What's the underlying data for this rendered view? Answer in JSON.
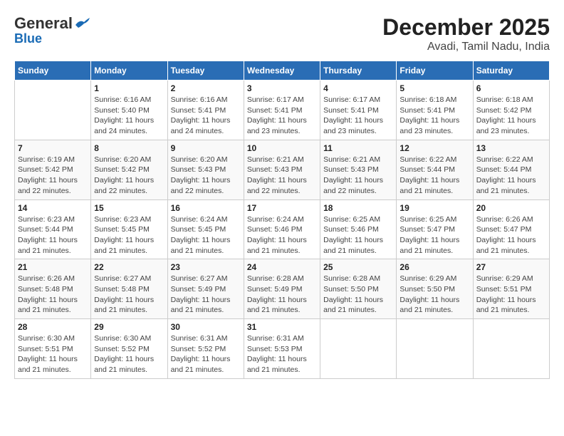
{
  "logo": {
    "general": "General",
    "blue": "Blue"
  },
  "title": "December 2025",
  "subtitle": "Avadi, Tamil Nadu, India",
  "days_of_week": [
    "Sunday",
    "Monday",
    "Tuesday",
    "Wednesday",
    "Thursday",
    "Friday",
    "Saturday"
  ],
  "weeks": [
    [
      {
        "day": "",
        "info": ""
      },
      {
        "day": "1",
        "info": "Sunrise: 6:16 AM\nSunset: 5:40 PM\nDaylight: 11 hours\nand 24 minutes."
      },
      {
        "day": "2",
        "info": "Sunrise: 6:16 AM\nSunset: 5:41 PM\nDaylight: 11 hours\nand 24 minutes."
      },
      {
        "day": "3",
        "info": "Sunrise: 6:17 AM\nSunset: 5:41 PM\nDaylight: 11 hours\nand 23 minutes."
      },
      {
        "day": "4",
        "info": "Sunrise: 6:17 AM\nSunset: 5:41 PM\nDaylight: 11 hours\nand 23 minutes."
      },
      {
        "day": "5",
        "info": "Sunrise: 6:18 AM\nSunset: 5:41 PM\nDaylight: 11 hours\nand 23 minutes."
      },
      {
        "day": "6",
        "info": "Sunrise: 6:18 AM\nSunset: 5:42 PM\nDaylight: 11 hours\nand 23 minutes."
      }
    ],
    [
      {
        "day": "7",
        "info": "Sunrise: 6:19 AM\nSunset: 5:42 PM\nDaylight: 11 hours\nand 22 minutes."
      },
      {
        "day": "8",
        "info": "Sunrise: 6:20 AM\nSunset: 5:42 PM\nDaylight: 11 hours\nand 22 minutes."
      },
      {
        "day": "9",
        "info": "Sunrise: 6:20 AM\nSunset: 5:43 PM\nDaylight: 11 hours\nand 22 minutes."
      },
      {
        "day": "10",
        "info": "Sunrise: 6:21 AM\nSunset: 5:43 PM\nDaylight: 11 hours\nand 22 minutes."
      },
      {
        "day": "11",
        "info": "Sunrise: 6:21 AM\nSunset: 5:43 PM\nDaylight: 11 hours\nand 22 minutes."
      },
      {
        "day": "12",
        "info": "Sunrise: 6:22 AM\nSunset: 5:44 PM\nDaylight: 11 hours\nand 21 minutes."
      },
      {
        "day": "13",
        "info": "Sunrise: 6:22 AM\nSunset: 5:44 PM\nDaylight: 11 hours\nand 21 minutes."
      }
    ],
    [
      {
        "day": "14",
        "info": "Sunrise: 6:23 AM\nSunset: 5:44 PM\nDaylight: 11 hours\nand 21 minutes."
      },
      {
        "day": "15",
        "info": "Sunrise: 6:23 AM\nSunset: 5:45 PM\nDaylight: 11 hours\nand 21 minutes."
      },
      {
        "day": "16",
        "info": "Sunrise: 6:24 AM\nSunset: 5:45 PM\nDaylight: 11 hours\nand 21 minutes."
      },
      {
        "day": "17",
        "info": "Sunrise: 6:24 AM\nSunset: 5:46 PM\nDaylight: 11 hours\nand 21 minutes."
      },
      {
        "day": "18",
        "info": "Sunrise: 6:25 AM\nSunset: 5:46 PM\nDaylight: 11 hours\nand 21 minutes."
      },
      {
        "day": "19",
        "info": "Sunrise: 6:25 AM\nSunset: 5:47 PM\nDaylight: 11 hours\nand 21 minutes."
      },
      {
        "day": "20",
        "info": "Sunrise: 6:26 AM\nSunset: 5:47 PM\nDaylight: 11 hours\nand 21 minutes."
      }
    ],
    [
      {
        "day": "21",
        "info": "Sunrise: 6:26 AM\nSunset: 5:48 PM\nDaylight: 11 hours\nand 21 minutes."
      },
      {
        "day": "22",
        "info": "Sunrise: 6:27 AM\nSunset: 5:48 PM\nDaylight: 11 hours\nand 21 minutes."
      },
      {
        "day": "23",
        "info": "Sunrise: 6:27 AM\nSunset: 5:49 PM\nDaylight: 11 hours\nand 21 minutes."
      },
      {
        "day": "24",
        "info": "Sunrise: 6:28 AM\nSunset: 5:49 PM\nDaylight: 11 hours\nand 21 minutes."
      },
      {
        "day": "25",
        "info": "Sunrise: 6:28 AM\nSunset: 5:50 PM\nDaylight: 11 hours\nand 21 minutes."
      },
      {
        "day": "26",
        "info": "Sunrise: 6:29 AM\nSunset: 5:50 PM\nDaylight: 11 hours\nand 21 minutes."
      },
      {
        "day": "27",
        "info": "Sunrise: 6:29 AM\nSunset: 5:51 PM\nDaylight: 11 hours\nand 21 minutes."
      }
    ],
    [
      {
        "day": "28",
        "info": "Sunrise: 6:30 AM\nSunset: 5:51 PM\nDaylight: 11 hours\nand 21 minutes."
      },
      {
        "day": "29",
        "info": "Sunrise: 6:30 AM\nSunset: 5:52 PM\nDaylight: 11 hours\nand 21 minutes."
      },
      {
        "day": "30",
        "info": "Sunrise: 6:31 AM\nSunset: 5:52 PM\nDaylight: 11 hours\nand 21 minutes."
      },
      {
        "day": "31",
        "info": "Sunrise: 6:31 AM\nSunset: 5:53 PM\nDaylight: 11 hours\nand 21 minutes."
      },
      {
        "day": "",
        "info": ""
      },
      {
        "day": "",
        "info": ""
      },
      {
        "day": "",
        "info": ""
      }
    ]
  ]
}
